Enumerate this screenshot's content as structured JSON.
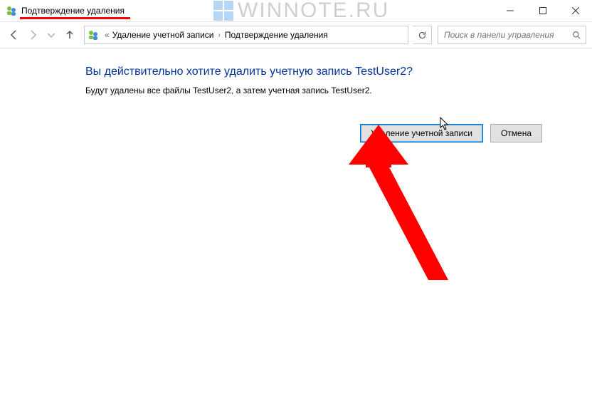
{
  "window": {
    "title": "Подтверждение удаления"
  },
  "watermark": "WINNOTE.RU",
  "breadcrumb": {
    "prefix": "«",
    "item1": "Удаление учетной записи",
    "item2": "Подтверждение удаления"
  },
  "search": {
    "placeholder": "Поиск в панели управления"
  },
  "main": {
    "heading": "Вы действительно хотите удалить учетную запись TestUser2?",
    "body": "Будут удалены все файлы TestUser2, а затем учетная запись TestUser2.",
    "delete_label": "Удаление учетной записи",
    "cancel_label": "Отмена"
  }
}
